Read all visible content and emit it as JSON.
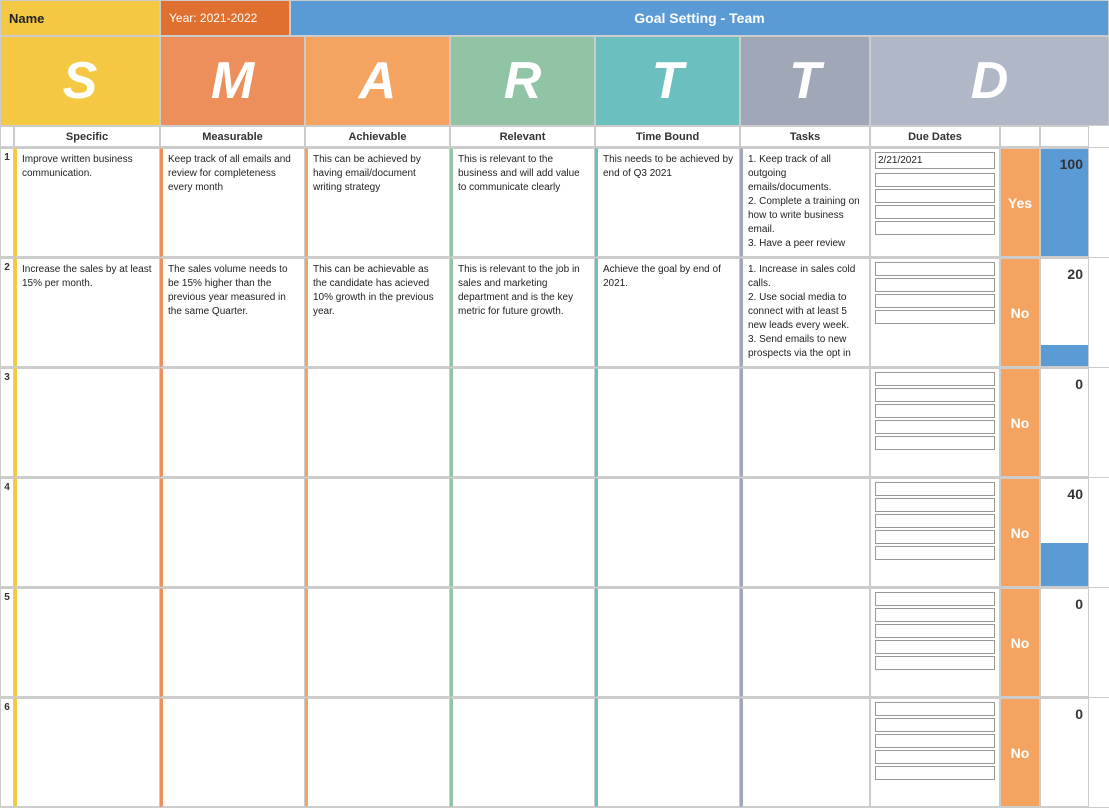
{
  "header": {
    "name_label": "Name",
    "year_label": "Year: 2021-2022",
    "title": "Goal Setting - Team"
  },
  "smart_letters": {
    "s": "S",
    "m": "M",
    "a": "A",
    "r": "R",
    "t1": "T",
    "t2": "T",
    "d": "D"
  },
  "column_headers": {
    "specific": "Specific",
    "measurable": "Measurable",
    "achievable": "Achievable",
    "relevant": "Relevant",
    "time_bound": "Time Bound",
    "tasks": "Tasks",
    "due_dates": "Due Dates"
  },
  "rows": [
    {
      "num": "1",
      "specific": "Improve written business communication.",
      "measurable": "Keep track of all emails and review for completeness every month",
      "achievable": "This can be achieved by having email/document writing strategy",
      "relevant": "This is relevant to the business and will add value to communicate clearly",
      "time_bound": "This needs to be achieved by end of Q3 2021",
      "tasks": "1. Keep track of all outgoing emails/documents.\n2. Complete a training on how to write business email.\n3. Have a peer review",
      "due_date_main": "2/21/2021",
      "due_date_lines": 4,
      "achieved": "Yes",
      "achieved_class": "achieved-yes",
      "percent": "100",
      "percent_height": 100
    },
    {
      "num": "2",
      "specific": "Increase the sales by at least 15% per month.",
      "measurable": "The sales volume needs to be 15% higher than the previous year measured in the same Quarter.",
      "achievable": "This can be achievable as the candidate has acieved 10% growth in the previous year.",
      "relevant": "This is relevant to the job in sales and marketing department and is the key metric for future growth.",
      "time_bound": "Achieve the goal by end of 2021.",
      "tasks": "1. Increase in sales cold calls.\n2. Use social media to connect with at least 5 new leads every week.\n3. Send emails to new prospects via the opt in",
      "due_date_main": "",
      "due_date_lines": 4,
      "achieved": "No",
      "achieved_class": "achieved-no",
      "percent": "20",
      "percent_height": 20
    },
    {
      "num": "3",
      "specific": "",
      "measurable": "",
      "achievable": "",
      "relevant": "",
      "time_bound": "",
      "tasks": "",
      "due_date_main": "",
      "due_date_lines": 5,
      "achieved": "No",
      "achieved_class": "achieved-no",
      "percent": "0",
      "percent_height": 0
    },
    {
      "num": "4",
      "specific": "",
      "measurable": "",
      "achievable": "",
      "relevant": "",
      "time_bound": "",
      "tasks": "",
      "due_date_main": "",
      "due_date_lines": 5,
      "achieved": "No",
      "achieved_class": "achieved-no",
      "percent": "40",
      "percent_height": 40
    },
    {
      "num": "5",
      "specific": "",
      "measurable": "",
      "achievable": "",
      "relevant": "",
      "time_bound": "",
      "tasks": "",
      "due_date_main": "",
      "due_date_lines": 5,
      "achieved": "No",
      "achieved_class": "achieved-no",
      "percent": "0",
      "percent_height": 0
    },
    {
      "num": "6",
      "specific": "",
      "measurable": "",
      "achievable": "",
      "relevant": "",
      "time_bound": "",
      "tasks": "",
      "due_date_main": "",
      "due_date_lines": 5,
      "achieved": "No",
      "achieved_class": "achieved-no",
      "percent": "0",
      "percent_height": 0
    }
  ]
}
